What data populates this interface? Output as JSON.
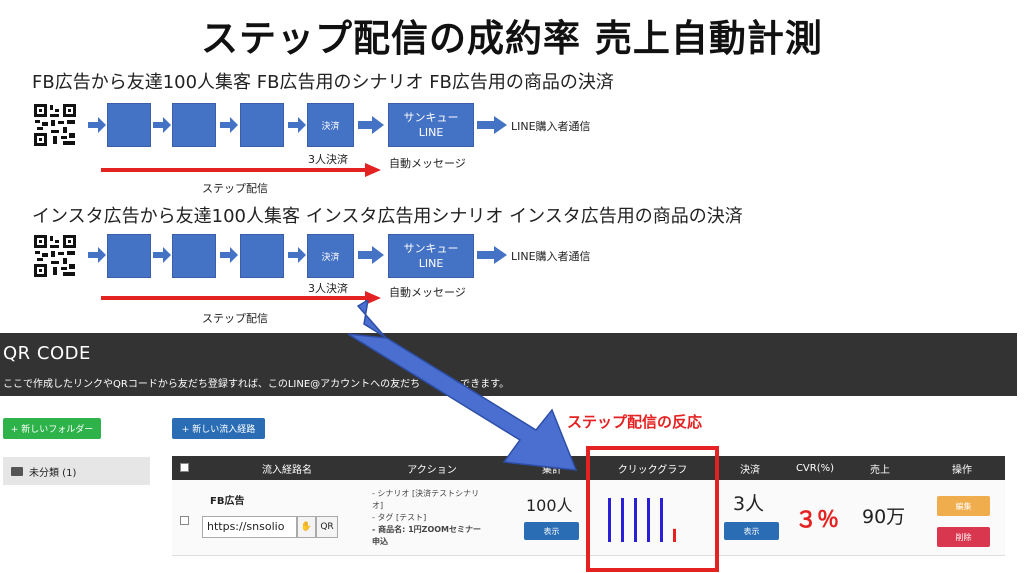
{
  "title": "ステップ配信の成約率 売上自動計測",
  "flows": [
    {
      "heading": "FB広告から友達100人集客 FB広告用のシナリオ FB広告用の商品の決済",
      "pay_box_label": "決済",
      "thanks_line1": "サンキュー",
      "thanks_line2": "LINE",
      "end_label": "LINE購入者通信",
      "pay_count_label": "3人決済",
      "auto_message_label": "自動メッセージ",
      "step_label": "ステップ配信"
    },
    {
      "heading": "インスタ広告から友達100人集客 インスタ広告用シナリオ インスタ広告用の商品の決済",
      "pay_box_label": "決済",
      "thanks_line1": "サンキュー",
      "thanks_line2": "LINE",
      "end_label": "LINE購入者通信",
      "pay_count_label": "3人決済",
      "auto_message_label": "自動メッセージ",
      "step_label": "ステップ配信"
    }
  ],
  "panel": {
    "title": "QR CODE",
    "description": "ここで作成したリンクやQRコードから友だち登録すれば、このLINE@アカウントへの友だち",
    "description_tail": "できます。",
    "new_folder_button": "+ 新しいフォルダー",
    "new_route_button": "+ 新しい流入経路",
    "folder_item": "未分類 (1)"
  },
  "reaction_label": "ステップ配信の反応",
  "table": {
    "headers": {
      "name": "流入経路名",
      "action": "アクション",
      "total": "集計",
      "click_graph": "クリックグラフ",
      "payment": "決済",
      "cvr": "CVR(%)",
      "sales": "売上",
      "operation": "操作"
    },
    "row": {
      "name": "FB広告",
      "url": "https://snsolio",
      "qr_button": "QR",
      "copy_icon": "stamp-icon",
      "action_line1": "- シナリオ [決済テストシナリオ]",
      "action_line2": "- タグ [テスト]",
      "action_line3": "- 商品名: 1円ZOOMセミナー申込",
      "total": "100人",
      "show_button": "表示",
      "payment": "3人",
      "payment_show_button": "表示",
      "cvr": "３％",
      "sales": "90万",
      "edit_button": "編集",
      "delete_button": "削除",
      "click_graph_bars": [
        1,
        1,
        1,
        1,
        1,
        0.3
      ]
    }
  },
  "colors": {
    "box_blue": "#4472c4",
    "red_accent": "#e52222",
    "graph_blue": "#2a1fd6",
    "header_dark": "#333333"
  }
}
